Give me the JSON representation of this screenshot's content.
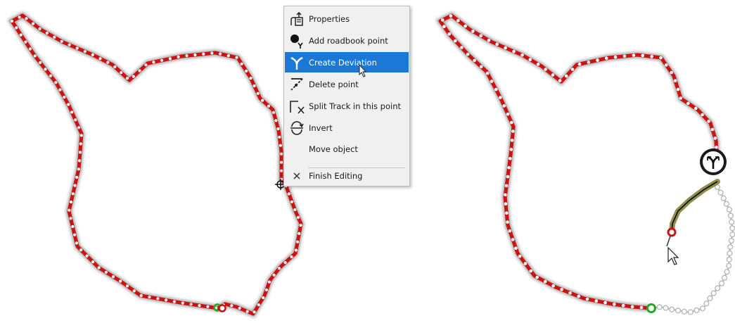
{
  "left_map": {
    "track_color": "#cc1111",
    "point_color": "#ffffff",
    "start_marker_color": "#22aa22",
    "end_marker_color": "#cc1111"
  },
  "context_menu": {
    "items": [
      {
        "label": "Properties",
        "icon": "properties-icon"
      },
      {
        "label": "Add roadbook point",
        "icon": "roadbook-point-icon"
      },
      {
        "label": "Create Deviation",
        "icon": "deviation-icon",
        "active": true
      },
      {
        "label": "Delete point",
        "icon": "delete-point-icon"
      },
      {
        "label": "Split Track in this point",
        "icon": "split-track-icon"
      },
      {
        "label": "Invert",
        "icon": "invert-icon"
      },
      {
        "label": "Move object",
        "icon": ""
      },
      {
        "label": "Finish Editing",
        "icon": "close-icon"
      }
    ],
    "highlight_color": "#1c78d6"
  },
  "right_map": {
    "track_color": "#cc1111",
    "deviation_color": "#7a7a2a",
    "ghost_track_color": "#b4b4b4",
    "deviation_marker_icon": "deviation-marker-icon"
  }
}
